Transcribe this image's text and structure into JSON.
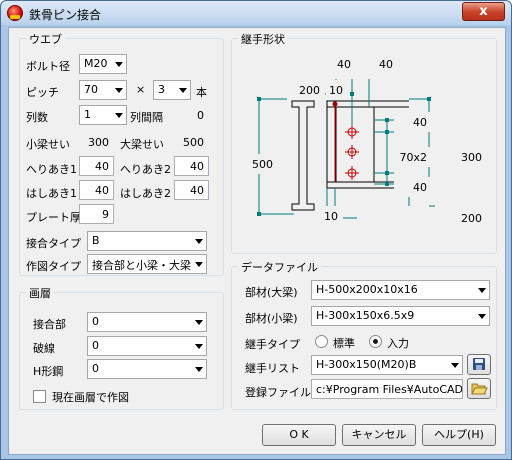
{
  "window": {
    "title": "鉄骨ピン接合",
    "close_label": "x"
  },
  "web": {
    "group_title": "ウエブ",
    "bolt_diameter_label": "ボルト径",
    "bolt_diameter_value": "M20",
    "pitch_label": "ピッチ",
    "pitch_value": "70",
    "times": "×",
    "count_value": "3",
    "count_unit": "本",
    "rows_label": "列数",
    "rows_value": "1",
    "row_spacing_label": "列間隔",
    "row_spacing_value": "0",
    "small_beam_depth_label": "小梁せい",
    "small_beam_depth_value": "300",
    "large_beam_depth_label": "大梁せい",
    "large_beam_depth_value": "500",
    "edge1_label": "へりあき1",
    "edge1_value": "40",
    "edge2_label": "へりあき2",
    "edge2_value": "40",
    "end1_label": "はしあき1",
    "end1_value": "40",
    "end2_label": "はしあき2",
    "end2_value": "40",
    "plate_thickness_label": "プレート厚",
    "plate_thickness_value": "9",
    "joint_type_label": "接合タイプ",
    "joint_type_value": "B",
    "draw_type_label": "作図タイプ",
    "draw_type_value": "接合部と小梁・大梁"
  },
  "layer": {
    "group_title": "画層",
    "joint_label": "接合部",
    "joint_value": "0",
    "dashed_label": "破線",
    "dashed_value": "0",
    "h_steel_label": "H形鋼",
    "h_steel_value": "0",
    "current_layer_label": "現在画層で作図"
  },
  "shape": {
    "group_title": "継手形状",
    "dims": {
      "top_a": "40",
      "top_b": "40",
      "w200": "200",
      "w10": "10",
      "r40a": "40",
      "r70x2": "70x2",
      "r40b": "40",
      "h500": "500",
      "h300": "300",
      "b10": "10",
      "b200": "200"
    }
  },
  "datafile": {
    "group_title": "データファイル",
    "large_member_label": "部材(大梁)",
    "large_member_value": "H-500x200x10x16",
    "small_member_label": "部材(小梁)",
    "small_member_value": "H-300x150x6.5x9",
    "joint_type_label": "継手タイプ",
    "radio_standard": "標準",
    "radio_input": "入力",
    "selected_radio": "入力",
    "joint_list_label": "継手リスト",
    "joint_list_value": "H-300x150(M20)B",
    "registry_label": "登録ファイル",
    "registry_value": "c:¥Program Files¥AutoCAD C"
  },
  "buttons": {
    "ok": "O K",
    "cancel": "キャンセル",
    "help": "ヘルプ(H)"
  },
  "icons": {
    "save": "floppy-disk-icon",
    "open": "folder-open-icon",
    "app": "app-icon"
  }
}
